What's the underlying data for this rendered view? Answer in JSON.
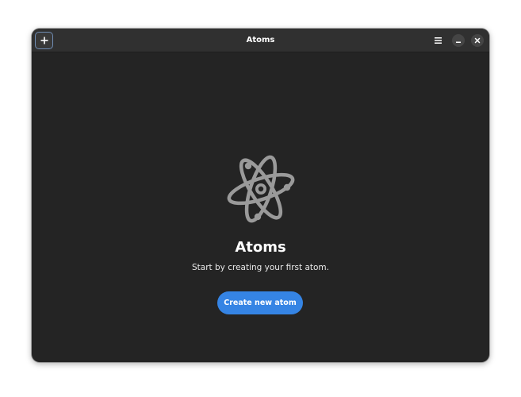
{
  "window": {
    "title": "Atoms"
  },
  "headerbar": {
    "add_icon": "plus-icon",
    "menu_icon": "hamburger-menu-icon",
    "minimize_icon": "minimize-icon",
    "close_icon": "close-icon"
  },
  "empty_state": {
    "icon": "atom-icon",
    "title": "Atoms",
    "description": "Start by creating your first atom.",
    "button_label": "Create new atom"
  },
  "colors": {
    "window_bg": "#242424",
    "headerbar_bg": "#303030",
    "accent": "#3584e4",
    "icon_gray": "#9a9a9a"
  }
}
